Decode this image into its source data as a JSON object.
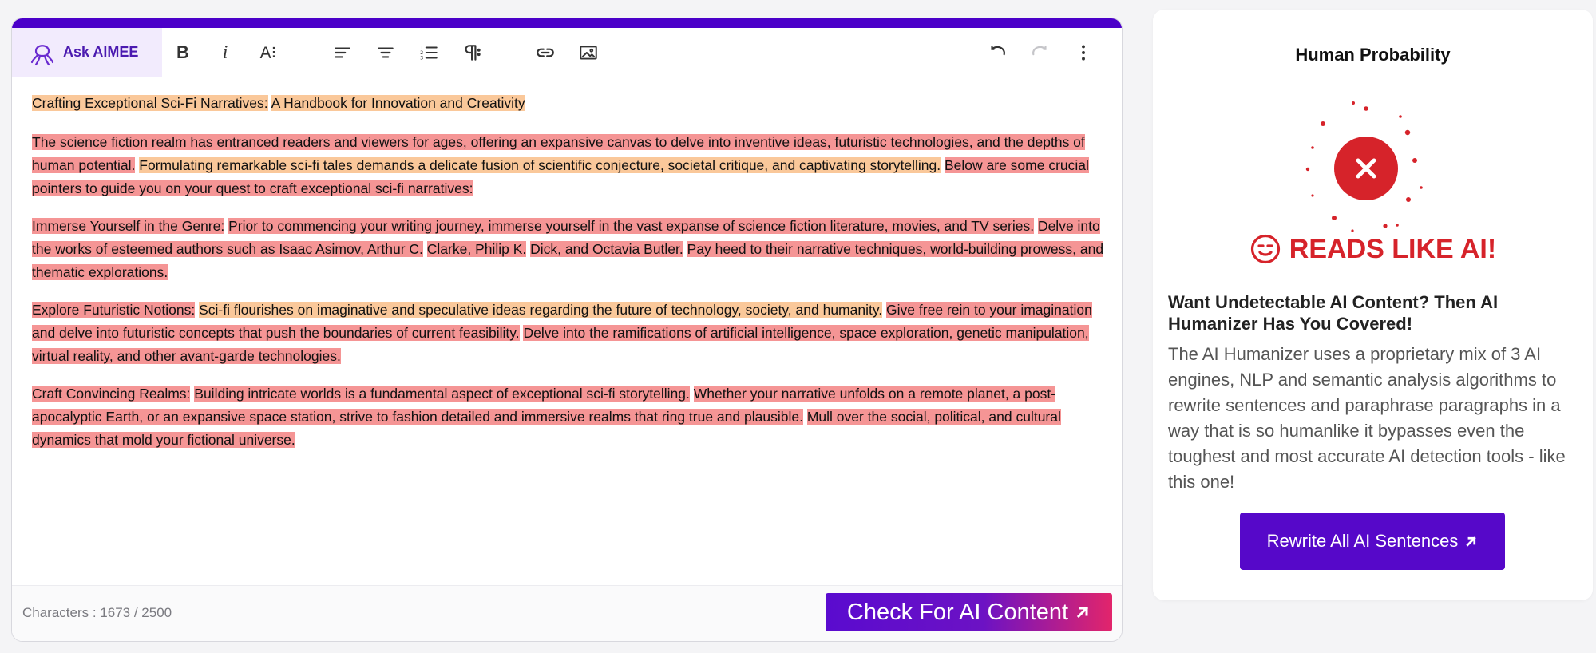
{
  "editor": {
    "ask_label": "Ask AIMEE",
    "toolbar": {
      "bold": "B",
      "italic": "i",
      "font_size": "A⁝"
    },
    "paragraphs": [
      [
        {
          "text": "Crafting Exceptional Sci-Fi Narratives:",
          "level": "orange"
        },
        {
          "text": " ",
          "level": "none"
        },
        {
          "text": "A Handbook for Innovation and Creativity",
          "level": "orange"
        }
      ],
      [
        {
          "text": "The science fiction realm has entranced readers and viewers for ages, offering an expansive canvas to delve into inventive ideas, futuristic technologies, and the depths of human potential.",
          "level": "red"
        },
        {
          "text": " ",
          "level": "none"
        },
        {
          "text": "Formulating remarkable sci-fi tales demands a delicate fusion of scientific conjecture, societal critique, and captivating storytelling.",
          "level": "orange"
        },
        {
          "text": " ",
          "level": "none"
        },
        {
          "text": "Below are some crucial pointers to guide you on your quest to craft exceptional sci-fi narratives:",
          "level": "red"
        }
      ],
      [
        {
          "text": "Immerse Yourself in the Genre:",
          "level": "red"
        },
        {
          "text": " ",
          "level": "none"
        },
        {
          "text": "Prior to commencing your writing journey, immerse yourself in the vast expanse of science fiction literature, movies, and TV series.",
          "level": "red"
        },
        {
          "text": " ",
          "level": "none"
        },
        {
          "text": "Delve into the works of esteemed authors such as Isaac Asimov, Arthur C.",
          "level": "red"
        },
        {
          "text": " ",
          "level": "none"
        },
        {
          "text": "Clarke, Philip K.",
          "level": "red"
        },
        {
          "text": " ",
          "level": "none"
        },
        {
          "text": "Dick, and Octavia Butler.",
          "level": "red"
        },
        {
          "text": " ",
          "level": "none"
        },
        {
          "text": "Pay heed to their narrative techniques, world-building prowess, and thematic explorations.",
          "level": "red"
        }
      ],
      [
        {
          "text": "Explore Futuristic Notions:",
          "level": "red"
        },
        {
          "text": " ",
          "level": "none"
        },
        {
          "text": "Sci-fi flourishes on imaginative and speculative ideas regarding the future of technology, society, and humanity.",
          "level": "orange"
        },
        {
          "text": " ",
          "level": "none"
        },
        {
          "text": "Give free rein to your imagination and delve into futuristic concepts that push the boundaries of current feasibility.",
          "level": "red"
        },
        {
          "text": " ",
          "level": "none"
        },
        {
          "text": "Delve into the ramifications of artificial intelligence, space exploration, genetic manipulation, virtual reality, and other avant-garde technologies.",
          "level": "red"
        }
      ],
      [
        {
          "text": "Craft Convincing Realms:",
          "level": "red"
        },
        {
          "text": " ",
          "level": "none"
        },
        {
          "text": "Building intricate worlds is a fundamental aspect of exceptional sci-fi storytelling.",
          "level": "red"
        },
        {
          "text": " ",
          "level": "none"
        },
        {
          "text": "Whether your narrative unfolds on a remote planet, a post-apocalyptic Earth, or an expansive space station, strive to fashion detailed and immersive realms that ring true and plausible.",
          "level": "red"
        },
        {
          "text": " ",
          "level": "none"
        },
        {
          "text": "Mull over the social, political, and cultural dynamics that mold your fictional universe.",
          "level": "red"
        }
      ]
    ],
    "footer": {
      "char_label": "Characters : 1673  / 2500",
      "check_label": "Check For AI Content"
    }
  },
  "panel": {
    "title": "Human Probability",
    "verdict": "READS LIKE AI!",
    "heading": "Want Undetectable AI Content? Then AI Humanizer Has You Covered!",
    "description": "The AI Humanizer uses a proprietary mix of 3 AI engines, NLP and semantic analysis algorithms to rewrite sentences and paraphrase paragraphs in a way that is so humanlike it bypasses even the toughest and most accurate AI detection tools - like this one!",
    "rewrite_label": "Rewrite All AI Sentences"
  },
  "colors": {
    "brand": "#4b00c9",
    "highlight_orange": "#fac89a",
    "highlight_red": "#f59595",
    "ai_red": "#d6232a",
    "gradient_end": "#e2256b"
  }
}
